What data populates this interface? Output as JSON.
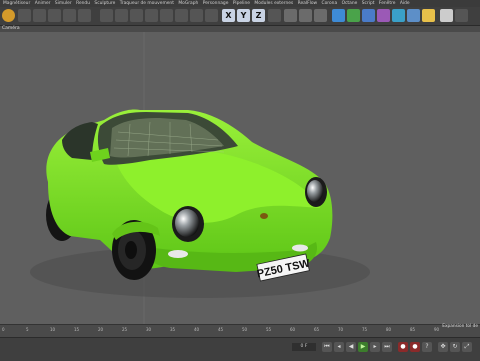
{
  "menu": [
    "Magnétiseur",
    "Animer",
    "Simuler",
    "Rendu",
    "Sculpture",
    "Traqueur de mouvement",
    "MoGraph",
    "Personnage",
    "Pipeline",
    "Modules externes",
    "RealFlow",
    "Corona",
    "Octane",
    "Script",
    "Fenêtre",
    "Aide"
  ],
  "toolbar": {
    "x_label": "X",
    "y_label": "Y",
    "z_label": "Z"
  },
  "viewport": {
    "label": "Caméra"
  },
  "car": {
    "plate": "PZ50 TSW",
    "body_color": "#7cea20"
  },
  "timeline": {
    "ticks": [
      "0",
      "5",
      "10",
      "15",
      "20",
      "25",
      "30",
      "35",
      "40",
      "45",
      "50",
      "55",
      "60",
      "65",
      "70",
      "75",
      "80",
      "85",
      "90"
    ],
    "status": "Expansion tol de"
  },
  "transport": {
    "frame": "0 F"
  }
}
